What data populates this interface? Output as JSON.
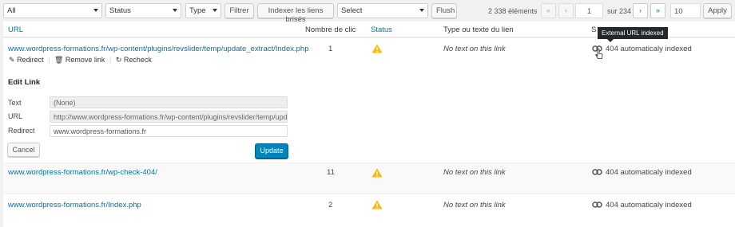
{
  "toolbar": {
    "filter_all": "All",
    "filter_status": "Status",
    "filter_type": "Type",
    "filter_button": "Filtrer",
    "index_button": "Indexer les liens brisés",
    "select": "Select",
    "flush_button": "Flush",
    "items_count": "2 338 éléments",
    "first_page": "«",
    "prev_page": "‹",
    "current_page": "1",
    "of_total": "sur 234",
    "next_page": "›",
    "last_page": "»",
    "per_page": "10",
    "apply_button": "Apply"
  },
  "columns": {
    "url": "URL",
    "clicks": "Nombre de clic",
    "status": "Status",
    "text": "Type ou texte du lien",
    "source": "S"
  },
  "rows": [
    {
      "url": "www.wordpress-formations.fr/wp-content/plugins/revslider/temp/update_extract/Index.php",
      "clicks": "1",
      "text": "No text on this link",
      "source": "404 automaticaly indexed"
    },
    {
      "url": "www.wordpress-formations.fr/wp-check-404/",
      "clicks": "11",
      "text": "No text on this link",
      "source": "404 automaticaly indexed"
    },
    {
      "url": "www.wordpress-formations.fr/Index.php",
      "clicks": "2",
      "text": "No text on this link",
      "source": "404 automaticaly indexed"
    }
  ],
  "row_actions": {
    "redirect": "Redirect",
    "remove": "Remove link",
    "recheck": "Recheck"
  },
  "edit": {
    "title": "Edit Link",
    "text_label": "Text",
    "text_value": "(None)",
    "url_label": "URL",
    "url_value": "http://www.wordpress-formations.fr/wp-content/plugins/revslider/temp/upd",
    "redirect_label": "Redirect",
    "redirect_value": "www.wordpress-formations.fr",
    "cancel_button": "Cancel",
    "update_button": "Update"
  },
  "tooltip": "External URL indexed",
  "colors": {
    "link": "#0073aa",
    "primary": "#0085ba",
    "warning": "#ffb900"
  }
}
